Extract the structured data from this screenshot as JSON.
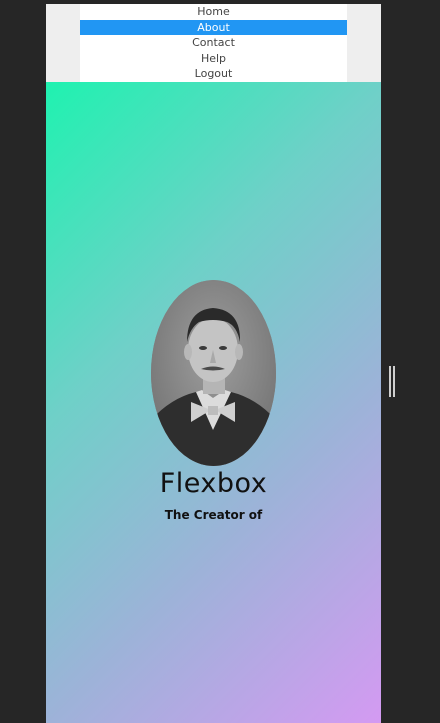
{
  "nav": {
    "items": [
      {
        "label": "Home",
        "active": false
      },
      {
        "label": "About",
        "active": true
      },
      {
        "label": "Contact",
        "active": false
      },
      {
        "label": "Help",
        "active": false
      },
      {
        "label": "Logout",
        "active": false
      }
    ],
    "active_color": "#2196f3"
  },
  "hero": {
    "title": "Flexbox",
    "subtitle": "The Creator of",
    "portrait_icon": "portrait-photo",
    "gradient_colors": [
      "#1ff2b0",
      "#9cb3d8",
      "#d49af2"
    ]
  }
}
